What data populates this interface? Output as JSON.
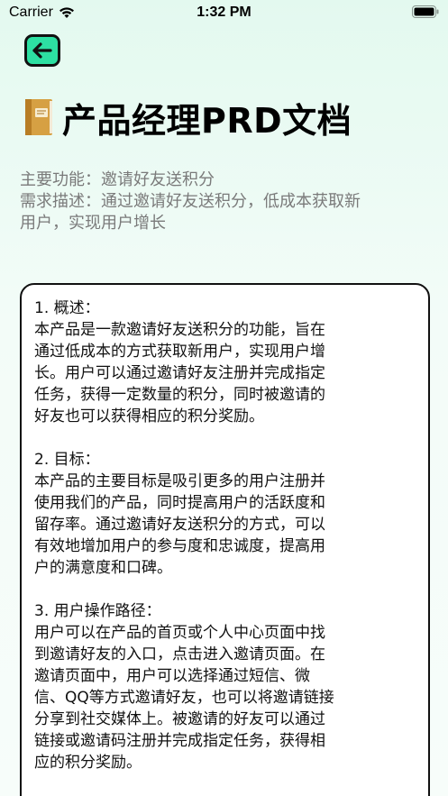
{
  "status_bar": {
    "carrier": "Carrier",
    "time": "1:32 PM"
  },
  "header": {
    "back_icon": "arrow-left-icon",
    "title_icon": "ledger-book-icon",
    "title": "产品经理PRD文档"
  },
  "meta": {
    "function": "主要功能：邀请好友送积分",
    "requirement_line1": "需求描述：通过邀请好友送积分，低成本获取新",
    "requirement_line2": "用户，实现用户增长"
  },
  "document": {
    "sections": [
      {
        "heading": "1. 概述：",
        "lines": [
          "本产品是一款邀请好友送积分的功能，旨在",
          "通过低成本的方式获取新用户，实现用户增",
          "长。用户可以通过邀请好友注册并完成指定",
          "任务，获得一定数量的积分，同时被邀请的",
          "好友也可以获得相应的积分奖励。"
        ]
      },
      {
        "heading": "2. 目标：",
        "lines": [
          "本产品的主要目标是吸引更多的用户注册并",
          "使用我们的产品，同时提高用户的活跃度和",
          "留存率。通过邀请好友送积分的方式，可以",
          "有效地增加用户的参与度和忠诚度，提高用",
          "户的满意度和口碑。"
        ]
      },
      {
        "heading": "3. 用户操作路径：",
        "lines": [
          "用户可以在产品的首页或个人中心页面中找",
          "到邀请好友的入口，点击进入邀请页面。在",
          "邀请页面中，用户可以选择通过短信、微",
          "信、QQ等方式邀请好友，也可以将邀请链接",
          "分享到社交媒体上。被邀请的好友可以通过",
          "链接或邀请码注册并完成指定任务，获得相",
          "应的积分奖励。"
        ]
      }
    ]
  },
  "colors": {
    "accent": "#2de0a2",
    "background": "#e9faf2",
    "meta_text": "#7a7a7a"
  }
}
